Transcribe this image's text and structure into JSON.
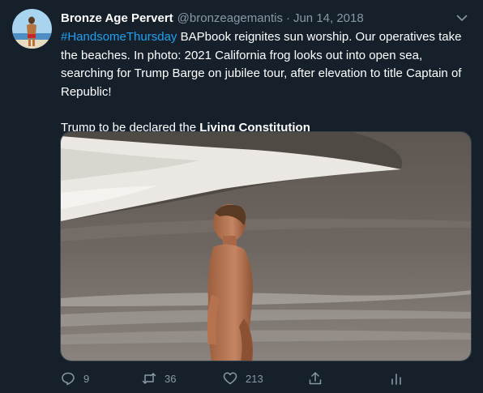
{
  "tweet": {
    "display_name": "Bronze Age Pervert",
    "handle": "@bronzeagemantis",
    "separator": "·",
    "date": "Jun 14, 2018",
    "hashtag": "#HandsomeThursday",
    "text_part1": " BAPbook reignites sun worship. Our operatives take the beaches. In photo: 2021 California frog looks out into open sea, searching for Trump Barge on jubilee tour, after elevation to title Captain of Republic!",
    "text_part2_plain": "Trump to be declared the ",
    "text_part2_bold": "Living Constitution",
    "media_description_icon": "photo-beach-icon"
  },
  "actions": {
    "reply_count": "9",
    "retweet_count": "36",
    "like_count": "213"
  },
  "colors": {
    "background": "#15202b",
    "accent": "#1da1f2",
    "muted": "#8899a6"
  }
}
